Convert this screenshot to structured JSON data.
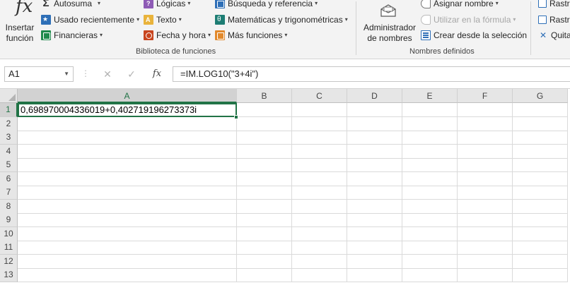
{
  "ribbon": {
    "insert_function": {
      "line1": "Insertar",
      "line2": "función"
    },
    "autosum": "Autosuma",
    "recent": "Usado recientemente",
    "financial": "Financieras",
    "logical": "Lógicas",
    "text": "Texto",
    "datetime": "Fecha y hora",
    "lookup": "Búsqueda y referencia",
    "math": "Matemáticas y trigonométricas",
    "more": "Más funciones",
    "library_label": "Biblioteca de funciones",
    "name_manager": {
      "line1": "Administrador",
      "line2": "de nombres"
    },
    "define_name": "Asignar nombre",
    "use_in_formula": "Utilizar en la fórmula",
    "create_from_selection": "Crear desde la selección",
    "defined_names_label": "Nombres definidos",
    "trace_precedents": "Rastr",
    "trace_dependents": "Rastr",
    "remove_arrows": "Quita"
  },
  "formula_bar": {
    "name_box": "A1",
    "formula": "=IM.LOG10(\"3+4i\")",
    "fx": "fx"
  },
  "sheet": {
    "columns": [
      "A",
      "B",
      "C",
      "D",
      "E",
      "F",
      "G"
    ],
    "rows": [
      "1",
      "2",
      "3",
      "4",
      "5",
      "6",
      "7",
      "8",
      "9",
      "10",
      "11",
      "12",
      "13"
    ],
    "cells": {
      "A1": "0,698970004336019+0,402719196273373i"
    },
    "selected": "A1"
  },
  "colors": {
    "excel_green": "#217346",
    "ribbon_bg": "#f3f3f3",
    "header_bg": "#e6e6e6"
  }
}
